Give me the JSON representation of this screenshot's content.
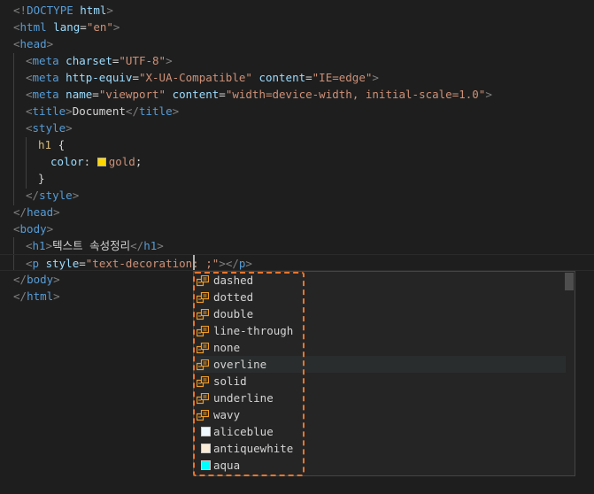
{
  "code": {
    "l1": {
      "open": "<!",
      "tag": "DOCTYPE",
      "space": " ",
      "attr": "html",
      "close": ">"
    },
    "l2": {
      "open": "<",
      "tag": "html",
      "sp": " ",
      "attr": "lang",
      "eq": "=",
      "val": "\"en\"",
      "close": ">"
    },
    "l3": {
      "open": "<",
      "tag": "head",
      "close": ">"
    },
    "l4": {
      "open": "<",
      "tag": "meta",
      "sp": " ",
      "attr": "charset",
      "eq": "=",
      "val": "\"UTF-8\"",
      "close": ">"
    },
    "l5": {
      "open": "<",
      "tag": "meta",
      "sp": " ",
      "attr1": "http-equiv",
      "eq1": "=",
      "val1": "\"X-UA-Compatible\"",
      "sp2": " ",
      "attr2": "content",
      "eq2": "=",
      "val2": "\"IE=edge\"",
      "close": ">"
    },
    "l6": {
      "open": "<",
      "tag": "meta",
      "sp": " ",
      "attr1": "name",
      "eq1": "=",
      "val1": "\"viewport\"",
      "sp2": " ",
      "attr2": "content",
      "eq2": "=",
      "val2": "\"width=device-width, initial-scale=1.0\"",
      "close": ">"
    },
    "l7": {
      "open": "<",
      "tag": "title",
      "close": ">",
      "text": "Document",
      "open2": "</",
      "tag2": "title",
      "close2": ">"
    },
    "l8": {
      "open": "<",
      "tag": "style",
      "close": ">"
    },
    "l9": {
      "sel": "h1",
      "brace": " {"
    },
    "l10": {
      "prop": "color",
      "colon": ": ",
      "value": "gold",
      "semi": ";",
      "swatch": "#ffd700"
    },
    "l11": {
      "brace": "}"
    },
    "l12": {
      "open": "</",
      "tag": "style",
      "close": ">"
    },
    "l13": {
      "open": "</",
      "tag": "head",
      "close": ">"
    },
    "l14": {
      "open": "<",
      "tag": "body",
      "close": ">"
    },
    "l15": {
      "open": "<",
      "tag": "h1",
      "close": ">",
      "text": "텍스트 속성정리",
      "open2": "</",
      "tag2": "h1",
      "close2": ">"
    },
    "l16": {
      "open": "<",
      "tag": "p",
      "sp": " ",
      "attr": "style",
      "eq": "=",
      "val": "\"text-decoration: ",
      "val2": ";\"",
      "close": ">",
      "open2": "</",
      "tag2": "p",
      "close2": ">"
    },
    "l17": {
      "open": "</",
      "tag": "body",
      "close": ">"
    },
    "l18": {
      "open": "</",
      "tag": "html",
      "close": ">"
    }
  },
  "suggest": {
    "items": [
      {
        "label": "dashed"
      },
      {
        "label": "dotted"
      },
      {
        "label": "double"
      },
      {
        "label": "line-through"
      },
      {
        "label": "none"
      },
      {
        "label": "overline"
      },
      {
        "label": "solid"
      },
      {
        "label": "underline"
      },
      {
        "label": "wavy"
      },
      {
        "label": "aliceblue",
        "color": "#f0f8ff"
      },
      {
        "label": "antiquewhite",
        "color": "#faebd7"
      },
      {
        "label": "aqua",
        "color": "#00ffff"
      }
    ],
    "icon": "enum-value-icon"
  },
  "colors": {
    "highlight": "#e8762c"
  }
}
